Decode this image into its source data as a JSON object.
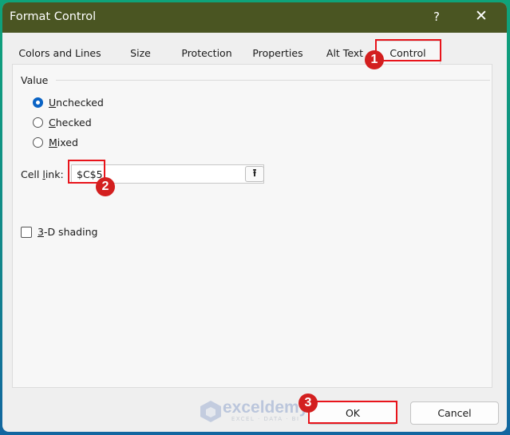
{
  "dialog": {
    "title": "Format Control",
    "help_glyph": "?",
    "close_glyph": "✕"
  },
  "tabs": [
    {
      "label": "Colors and Lines",
      "active": false
    },
    {
      "label": "Size",
      "active": false
    },
    {
      "label": "Protection",
      "active": false
    },
    {
      "label": "Properties",
      "active": false
    },
    {
      "label": "Alt Text",
      "active": false
    },
    {
      "label": "Control",
      "active": true
    }
  ],
  "value_group": {
    "label": "Value",
    "options": [
      {
        "accel": "U",
        "rest": "nchecked",
        "selected": true
      },
      {
        "accel": "C",
        "rest": "hecked",
        "selected": false
      },
      {
        "accel": "M",
        "rest": "ixed",
        "selected": false
      }
    ]
  },
  "cell_link": {
    "label_pre": "Cell ",
    "label_accel": "l",
    "label_post": "ink:",
    "value": "$C$5",
    "collapse_icon": "upload-arrow-icon",
    "collapse_glyph": "⭱"
  },
  "shading": {
    "accel": "3",
    "rest": "-D shading",
    "checked": false
  },
  "buttons": {
    "ok": "OK",
    "cancel": "Cancel"
  },
  "annotations": {
    "step1": "1",
    "step2": "2",
    "step3": "3",
    "color": "#e8141b"
  },
  "watermark": {
    "brand": "exceldemy",
    "tagline": "EXCEL · DATA · BI"
  }
}
